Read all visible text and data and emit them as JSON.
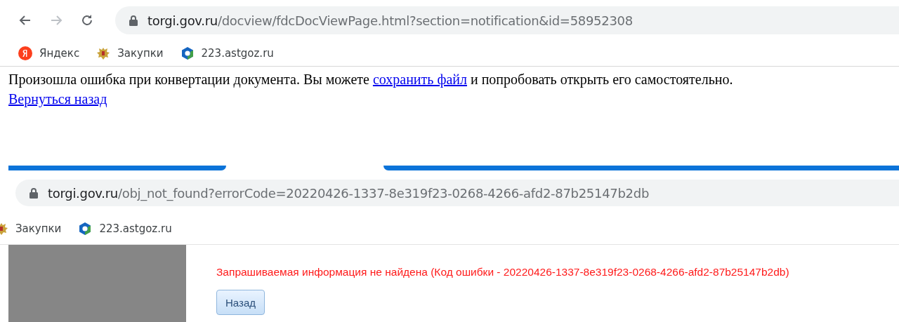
{
  "browser_top": {
    "url_host": "torgi.gov.ru",
    "url_path": "/docview/fdcDocViewPage.html?section=notification&id=58952308",
    "bookmarks": [
      {
        "label": "Яндекс",
        "kind": "yandex"
      },
      {
        "label": "Закупки",
        "kind": "emblem"
      },
      {
        "label": "223.astgoz.ru",
        "kind": "hex"
      }
    ]
  },
  "page_top": {
    "message": {
      "before": "Произошла ошибка при конвертации документа. Вы можете ",
      "link": "сохранить файл",
      "after": " и попробовать открыть его самостоятельно."
    },
    "back_link": "Вернуться назад"
  },
  "browser_bottom": {
    "url_host": "torgi.gov.ru",
    "url_path": "/obj_not_found?errorCode=20220426-1337-8e319f23-0268-4266-afd2-87b25147b2db",
    "bookmarks": [
      {
        "label": "Закупки",
        "kind": "emblem"
      },
      {
        "label": "223.astgoz.ru",
        "kind": "hex"
      }
    ]
  },
  "page_bottom": {
    "error": "Запрашиваемая информация не найдена (Код ошибки - 20220426-1337-8e319f23-0268-4266-afd2-87b25147b2db)",
    "button": "Назад"
  }
}
